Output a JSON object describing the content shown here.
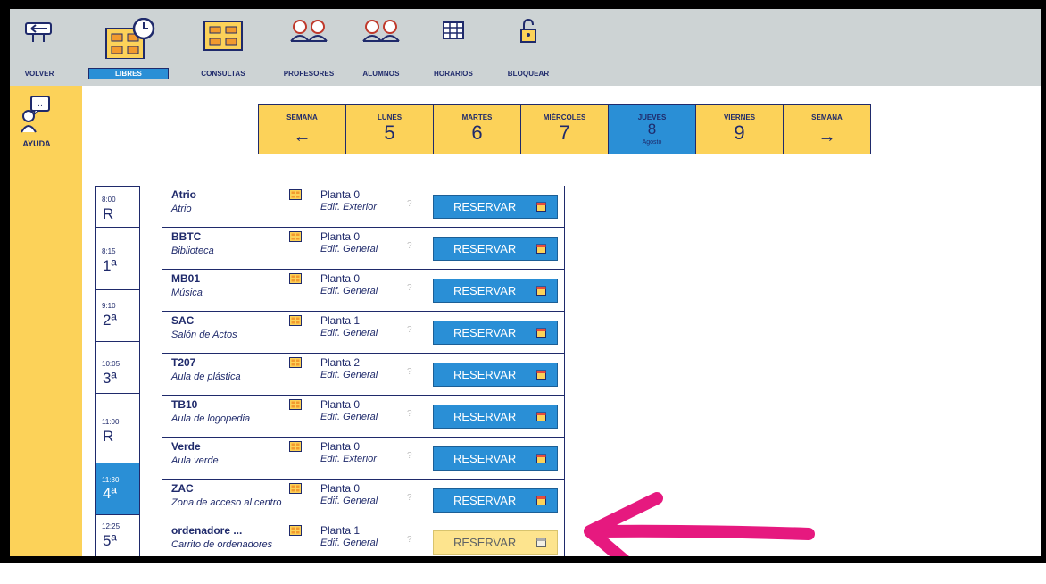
{
  "toolbar": {
    "items": [
      {
        "label": "VOLVER",
        "icon": "back-sign-icon"
      },
      {
        "label": "LIBRES",
        "icon": "free-rooms-clock-icon",
        "active": true
      },
      {
        "label": "CONSULTAS",
        "icon": "consultations-icon"
      },
      {
        "label": "PROFESORES",
        "icon": "teachers-icon"
      },
      {
        "label": "ALUMNOS",
        "icon": "students-icon"
      },
      {
        "label": "HORARIOS",
        "icon": "schedule-grid-icon"
      },
      {
        "label": "BLOQUEAR",
        "icon": "padlock-icon"
      }
    ]
  },
  "sidebar": {
    "help_label": "AYUDA",
    "help_icon": "help-person-icon"
  },
  "days": [
    {
      "name": "SEMANA",
      "arrow": "←",
      "kind": "prev-week"
    },
    {
      "name": "LUNES",
      "number": "5"
    },
    {
      "name": "MARTES",
      "number": "6"
    },
    {
      "name": "MIÉRCOLES",
      "number": "7"
    },
    {
      "name": "JUEVES",
      "number": "8",
      "sub": "Agosto",
      "active": true
    },
    {
      "name": "VIERNES",
      "number": "9"
    },
    {
      "name": "SEMANA",
      "arrow": "→",
      "kind": "next-week"
    }
  ],
  "periods": [
    {
      "time": "8:00",
      "label": "R"
    },
    {
      "time": "8:15",
      "label": "1ª"
    },
    {
      "time": "9:10",
      "label": "2ª"
    },
    {
      "time": "10:05",
      "label": "3ª"
    },
    {
      "time": "11:00",
      "label": "R"
    },
    {
      "time": "11:30",
      "label": "4ª",
      "active": true
    },
    {
      "time": "12:25",
      "label": "5ª"
    }
  ],
  "rooms": [
    {
      "code": "Atrio",
      "name": "Atrio",
      "floor": "Planta 0",
      "building": "Edif. Exterior",
      "help": "?",
      "action": "RESERVAR",
      "enabled": true
    },
    {
      "code": "BBTC",
      "name": "Biblioteca",
      "floor": "Planta 0",
      "building": "Edif. General",
      "help": "?",
      "action": "RESERVAR",
      "enabled": true
    },
    {
      "code": "MB01",
      "name": "Música",
      "floor": "Planta 0",
      "building": "Edif. General",
      "help": "?",
      "action": "RESERVAR",
      "enabled": true
    },
    {
      "code": "SAC",
      "name": "Salón de Actos",
      "floor": "Planta 1",
      "building": "Edif. General",
      "help": "?",
      "action": "RESERVAR",
      "enabled": true
    },
    {
      "code": "T207",
      "name": "Aula de plástica",
      "floor": "Planta 2",
      "building": "Edif. General",
      "help": "?",
      "action": "RESERVAR",
      "enabled": true
    },
    {
      "code": "TB10",
      "name": "Aula de logopedia",
      "floor": "Planta 0",
      "building": "Edif. General",
      "help": "?",
      "action": "RESERVAR",
      "enabled": true
    },
    {
      "code": "Verde",
      "name": "Aula verde",
      "floor": "Planta 0",
      "building": "Edif. Exterior",
      "help": "?",
      "action": "RESERVAR",
      "enabled": true
    },
    {
      "code": "ZAC",
      "name": "Zona de acceso al centro",
      "floor": "Planta 0",
      "building": "Edif. General",
      "help": "?",
      "action": "RESERVAR",
      "enabled": true
    },
    {
      "code": "ordenadore ...",
      "name": "Carrito de ordenadores",
      "floor": "Planta 1",
      "building": "Edif. General",
      "help": "?",
      "action": "RESERVAR",
      "enabled": false
    }
  ],
  "colors": {
    "navy": "#1f2a6b",
    "yellow": "#fcd259",
    "blue": "#2a8fd6",
    "toolbar_gray": "#cdd3d4",
    "pointer_pink": "#e6197f"
  }
}
